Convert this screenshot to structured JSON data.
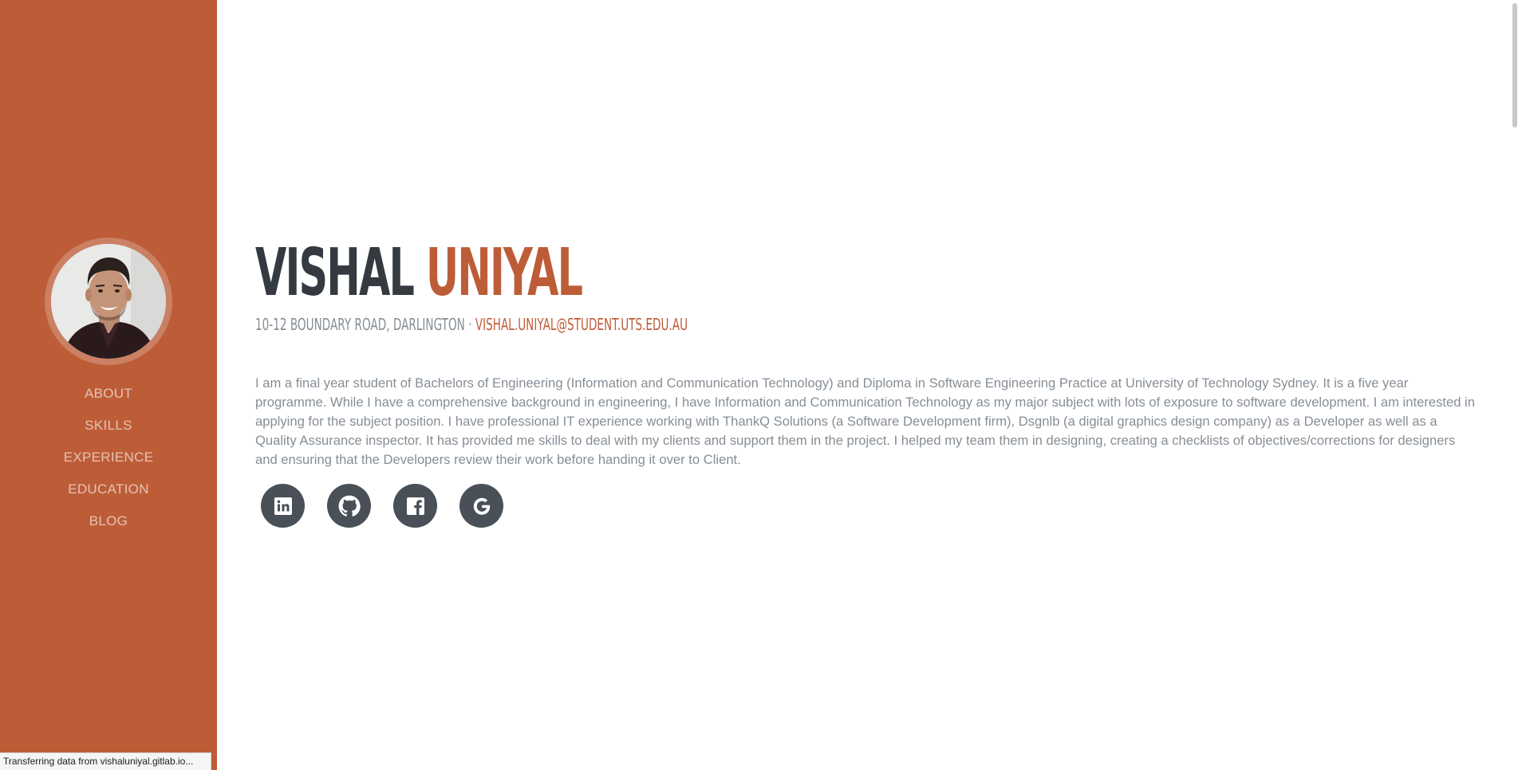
{
  "brand_color": "#bd5d38",
  "sidebar": {
    "avatar_alt": "",
    "nav": [
      {
        "label": "ABOUT"
      },
      {
        "label": "SKILLS"
      },
      {
        "label": "EXPERIENCE"
      },
      {
        "label": "EDUCATION"
      },
      {
        "label": "BLOG"
      }
    ]
  },
  "header": {
    "first_name": "VISHAL",
    "last_name": "UNIYAL",
    "address": "10-12 Boundary Road, Darlington ·",
    "email": "vishal.uniyal@student.uts.edu.au"
  },
  "about": {
    "bio": "I am a final year student of Bachelors of Engineering (Information and Communication Technology) and Diploma in Software Engineering Practice at University of Technology Sydney. It is a five year programme. While I have a comprehensive background in engineering, I have Information and Communication Technology as my major subject with lots of exposure to software development. I am interested in applying for the subject position. I have professional IT experience working with ThankQ Solutions (a Software Development firm), Dsgnlb (a digital graphics design company) as a Developer as well as a Quality Assurance inspector. It has provided me skills to deal with my clients and support them in the project. I helped my team them in designing, creating a checklists of objectives/corrections for designers and ensuring that the Developers review their work before handing it over to Client."
  },
  "social": [
    {
      "icon": "linkedin-icon"
    },
    {
      "icon": "github-icon"
    },
    {
      "icon": "facebook-icon"
    },
    {
      "icon": "google-icon"
    }
  ],
  "status_bar": {
    "text": "Transferring data from vishaluniyal.gitlab.io..."
  }
}
